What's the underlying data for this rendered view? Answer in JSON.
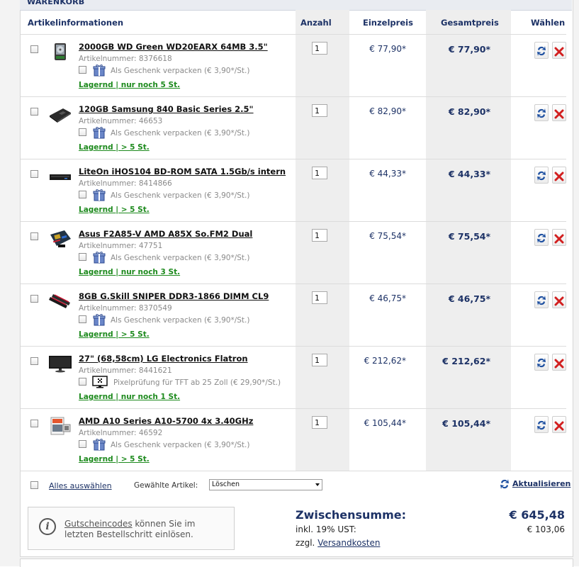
{
  "cart": {
    "title": "WARENKORB",
    "headers": {
      "info": "Artikelinformationen",
      "qty": "Anzahl",
      "unit_price": "Einzelpreis",
      "total_price": "Gesamtpreis",
      "select": "Wählen"
    },
    "artnr_label": "Artikelnummer:",
    "items": [
      {
        "name": "2000GB WD Green WD20EARX 64MB 3.5\"",
        "artnr": "8376618",
        "option": "Als Geschenk verpacken (€ 3,90*/St.)",
        "stock": "Lagernd | nur noch 5 St.",
        "qty": "1",
        "unit_price": "€ 77,90*",
        "total_price": "€ 77,90*",
        "thumb_icon": "hdd-icon"
      },
      {
        "name": "120GB Samsung 840 Basic Series 2.5\"",
        "artnr": "46653",
        "option": "Als Geschenk verpacken (€ 3,90*/St.)",
        "stock": "Lagernd | > 5 St.",
        "qty": "1",
        "unit_price": "€ 82,90*",
        "total_price": "€ 82,90*",
        "thumb_icon": "ssd-icon"
      },
      {
        "name": "LiteOn iHOS104 BD-ROM SATA 1.5Gb/s intern",
        "artnr": "8414866",
        "option": "Als Geschenk verpacken (€ 3,90*/St.)",
        "stock": "Lagernd | > 5 St.",
        "qty": "1",
        "unit_price": "€ 44,33*",
        "total_price": "€ 44,33*",
        "thumb_icon": "optical-drive-icon"
      },
      {
        "name": "Asus F2A85-V AMD A85X So.FM2 Dual",
        "artnr": "47751",
        "option": "Als Geschenk verpacken (€ 3,90*/St.)",
        "stock": "Lagernd | nur noch 3 St.",
        "qty": "1",
        "unit_price": "€ 75,54*",
        "total_price": "€ 75,54*",
        "thumb_icon": "mainboard-icon"
      },
      {
        "name": "8GB G.Skill SNIPER DDR3-1866 DIMM CL9",
        "artnr": "8370549",
        "option": "Als Geschenk verpacken (€ 3,90*/St.)",
        "stock": "Lagernd | > 5 St.",
        "qty": "1",
        "unit_price": "€ 46,75*",
        "total_price": "€ 46,75*",
        "thumb_icon": "ram-icon"
      },
      {
        "name": "27\" (68,58cm) LG Electronics Flatron",
        "artnr": "8441621",
        "option": "Pixelprüfung für TFT ab 25 Zoll (€ 29,90*/St.)",
        "stock": "Lagernd | nur noch 1 St.",
        "qty": "1",
        "unit_price": "€ 212,62*",
        "total_price": "€ 212,62*",
        "thumb_icon": "monitor-icon"
      },
      {
        "name": "AMD A10 Series A10-5700 4x 3.40GHz",
        "artnr": "46592",
        "option": "Als Geschenk verpacken (€ 3,90*/St.)",
        "stock": "Lagernd | > 5 St.",
        "qty": "1",
        "unit_price": "€ 105,44*",
        "total_price": "€ 105,44*",
        "thumb_icon": "cpu-box-icon"
      }
    ],
    "footer": {
      "select_all": "Alles auswählen",
      "selected_label": "Gewählte Artikel:",
      "action_value": "Löschen",
      "update": "Aktualisieren"
    }
  },
  "coupon": {
    "link": "Gutscheincodes",
    "text1": " können Sie im",
    "text2": "letzten Bestellschritt einlösen."
  },
  "summary": {
    "subtotal_label": "Zwischensumme:",
    "subtotal_value": "€ 645,48",
    "vat_label": "inkl. 19% UST:",
    "vat_value": "€ 103,06",
    "shipping_prefix": "zzgl.",
    "shipping_link": "Versandkosten"
  },
  "colors": {
    "brand": "#1d3266",
    "stock_green": "#1d8a1d",
    "delete_red": "#d21f1f"
  }
}
